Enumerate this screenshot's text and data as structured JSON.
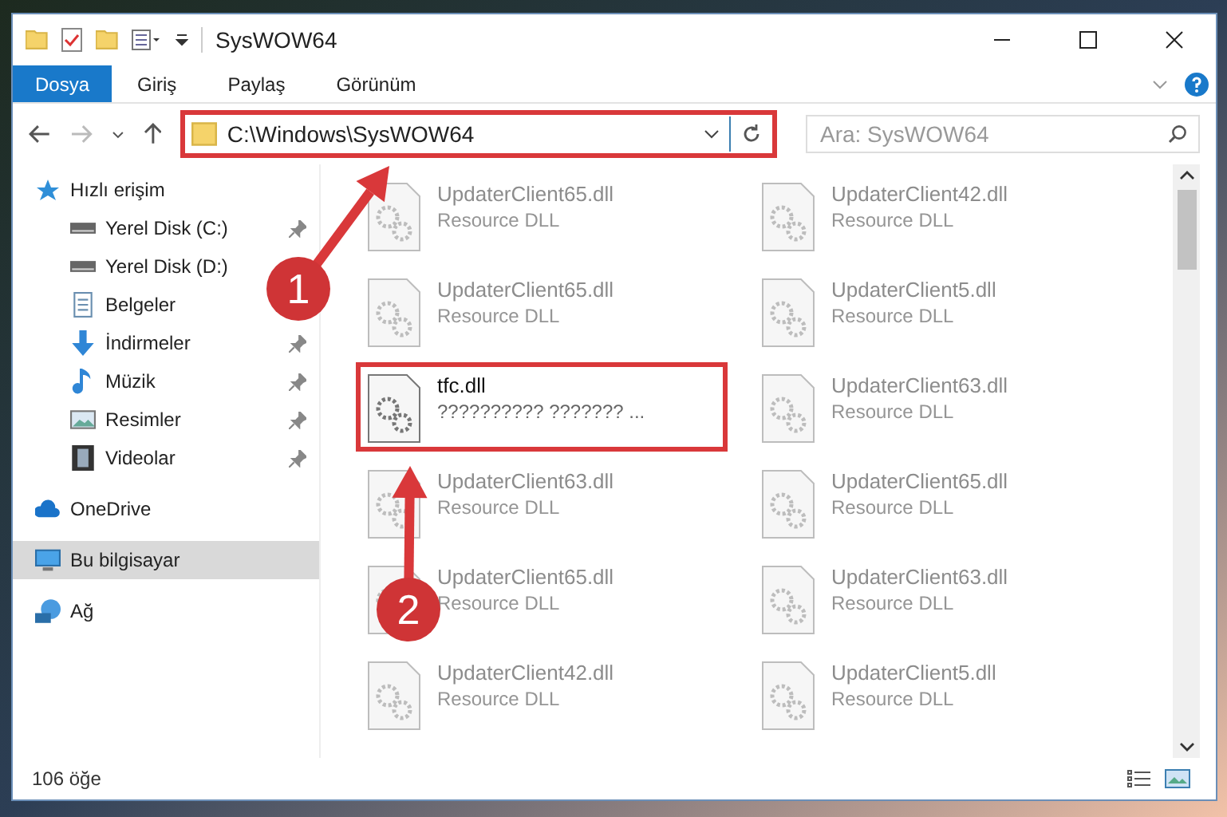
{
  "window": {
    "title": "SysWOW64"
  },
  "ribbon_tabs": [
    {
      "label": "Dosya",
      "selected": true
    },
    {
      "label": "Giriş",
      "selected": false
    },
    {
      "label": "Paylaş",
      "selected": false
    },
    {
      "label": "Görünüm",
      "selected": false
    }
  ],
  "address_bar": {
    "path": "C:\\Windows\\SysWOW64",
    "highlighted": true
  },
  "search": {
    "placeholder": "Ara: SysWOW64"
  },
  "sidebar": {
    "items": [
      {
        "label": "Hızlı erişim",
        "selected": false,
        "children": [
          {
            "label": "Yerel Disk (C:)",
            "pinned": true,
            "selected": false
          },
          {
            "label": "Yerel Disk (D:)",
            "pinned": false,
            "selected": false
          },
          {
            "label": "Belgeler",
            "pinned": false,
            "selected": false
          },
          {
            "label": "İndirmeler",
            "pinned": true,
            "selected": false
          },
          {
            "label": "Müzik",
            "pinned": true,
            "selected": false
          },
          {
            "label": "Resimler",
            "pinned": true,
            "selected": false
          },
          {
            "label": "Videolar",
            "pinned": true,
            "selected": false
          }
        ]
      },
      {
        "label": "OneDrive",
        "selected": false
      },
      {
        "label": "Bu bilgisayar",
        "selected": true
      },
      {
        "label": "Ağ",
        "selected": false
      }
    ]
  },
  "files": [
    {
      "name": "UpdaterClient65.dll",
      "description": "Resource DLL",
      "kind": "faded"
    },
    {
      "name": "UpdaterClient42.dll",
      "description": "Resource DLL",
      "kind": "faded"
    },
    {
      "name": "UpdaterClient65.dll",
      "description": "Resource DLL",
      "kind": "faded"
    },
    {
      "name": "UpdaterClient5.dll",
      "description": "Resource DLL",
      "kind": "faded"
    },
    {
      "name": "tfc.dll",
      "description": "?????????? ??????? ...",
      "kind": "highlighted"
    },
    {
      "name": "UpdaterClient63.dll",
      "description": "Resource DLL",
      "kind": "faded"
    },
    {
      "name": "UpdaterClient63.dll",
      "description": "Resource DLL",
      "kind": "faded"
    },
    {
      "name": "UpdaterClient65.dll",
      "description": "Resource DLL",
      "kind": "faded"
    },
    {
      "name": "UpdaterClient65.dll",
      "description": "Resource DLL",
      "kind": "faded"
    },
    {
      "name": "UpdaterClient63.dll",
      "description": "Resource DLL",
      "kind": "faded"
    },
    {
      "name": "UpdaterClient42.dll",
      "description": "Resource DLL",
      "kind": "faded"
    },
    {
      "name": "UpdaterClient5.dll",
      "description": "Resource DLL",
      "kind": "faded"
    }
  ],
  "status_bar": {
    "item_count": "106 öğe"
  },
  "annotations": [
    {
      "number": "1"
    },
    {
      "number": "2"
    }
  ]
}
